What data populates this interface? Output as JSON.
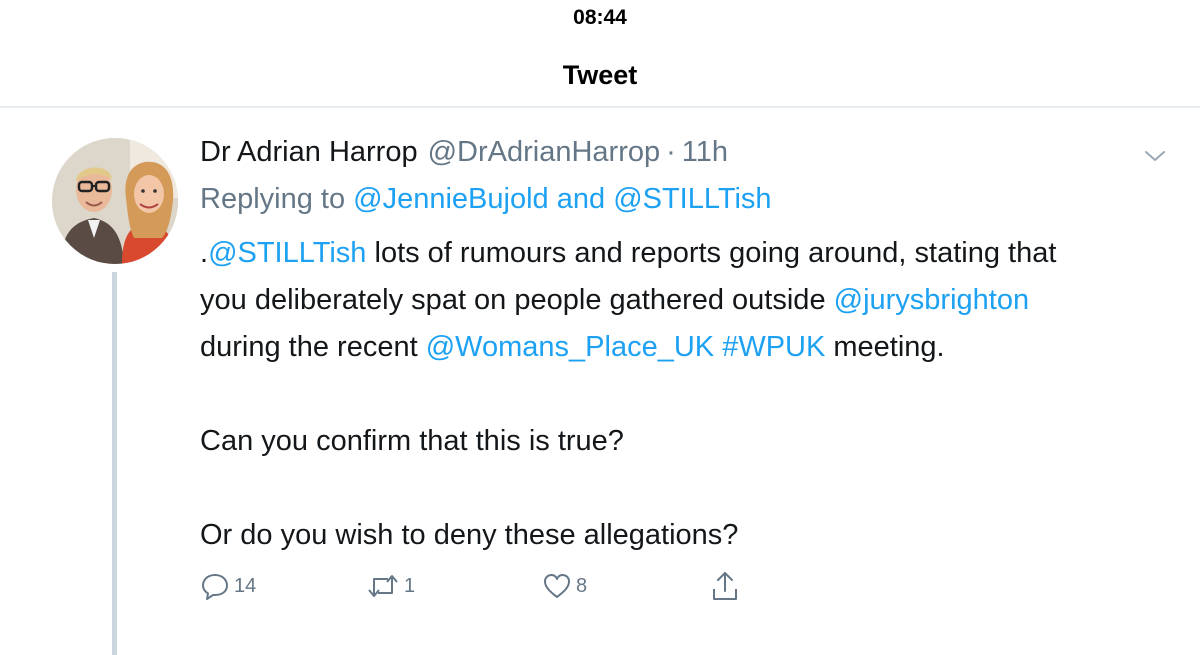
{
  "status_bar": {
    "time": "08:44"
  },
  "nav": {
    "title": "Tweet"
  },
  "tweet": {
    "display_name": "Dr Adrian Harrop",
    "handle": "@DrAdrianHarrop",
    "separator": "·",
    "time_ago": "11h",
    "replying_prefix": "Replying to",
    "reply_user_1": "@JennieBujold",
    "reply_conjunction": "and",
    "reply_user_2": "@STILLTish",
    "body": {
      "line1_prefix": ".",
      "line1_mention": "@STILLTish",
      "line1_rest": " lots of rumours and reports going around, stating that",
      "line2_text": "you deliberately spat on people gathered outside ",
      "line2_mention": "@jurysbrighton",
      "line3_text": "during the recent ",
      "line3_mention": "@Womans_Place_UK",
      "line3_hashtag": "#WPUK",
      "line3_rest": " meeting.",
      "para2": "Can you confirm that this is true?",
      "para3": "Or do you wish to deny these allegations?"
    },
    "counts": {
      "replies": "14",
      "retweets": "1",
      "likes": "8"
    }
  },
  "icons": {
    "reply": "reply-icon",
    "retweet": "retweet-icon",
    "like": "heart-icon",
    "share": "share-icon",
    "chevron": "chevron-down-icon"
  },
  "colors": {
    "link": "#1da1f2",
    "muted": "#657786",
    "text": "#14171a",
    "divider": "#e6ecf0"
  }
}
